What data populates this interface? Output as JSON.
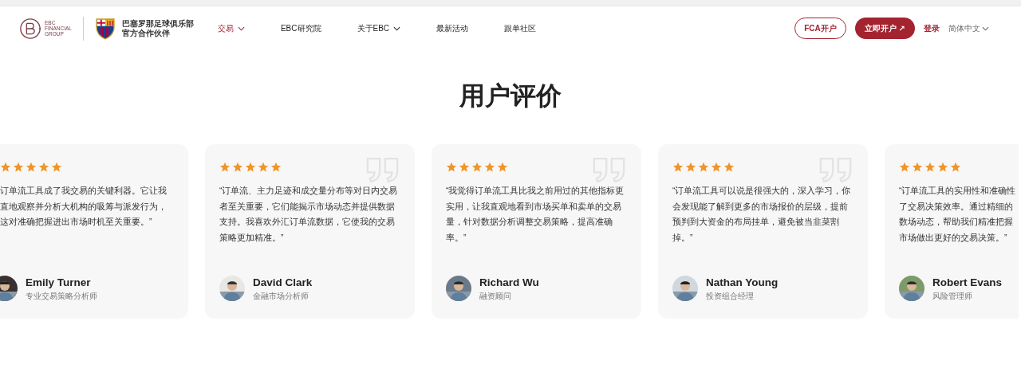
{
  "header": {
    "logo_text": [
      "EBC",
      "FINANCIAL",
      "GROUP"
    ],
    "partner_text": [
      "巴塞罗那足球俱乐部",
      "官方合作伙伴"
    ],
    "nav": [
      {
        "label": "交易",
        "selected": true,
        "dropdown": true
      },
      {
        "label": "EBC研究院",
        "selected": false,
        "dropdown": false
      },
      {
        "label": "关于EBC",
        "selected": false,
        "dropdown": true
      },
      {
        "label": "最新活动",
        "selected": false,
        "dropdown": false
      },
      {
        "label": "跟单社区",
        "selected": false,
        "dropdown": false
      }
    ],
    "fca_button": "FCA开户",
    "open_button": "立即开户 ↗",
    "login": "登录",
    "language": "简体中文"
  },
  "title": "用户评价",
  "reviews": [
    {
      "kind": "cut-left",
      "stars": 5,
      "quote": "订单流工具成了我交易的关键利器。它让我直地观察并分析大机构的吸筹与派发行为，这对准确把握进出市场时机至关重要。”",
      "name": "Emily Turner",
      "role": "专业交易策略分析师"
    },
    {
      "kind": "full",
      "stars": 5,
      "quote": "“订单流、主力足迹和成交量分布等对日内交易者至关重要，它们能揭示市场动态并提供数据支持。我喜欢外汇订单流数据，它使我的交易策略更加精准。”",
      "name": "David Clark",
      "role": "金融市场分析师"
    },
    {
      "kind": "full",
      "stars": 5,
      "quote": "“我觉得订单流工具比我之前用过的其他指标更实用，让我直观地看到市场买单和卖单的交易量，针对数据分析调整交易策略，提高准确率。”",
      "name": "Richard Wu",
      "role": "融资顾问"
    },
    {
      "kind": "full",
      "stars": 5,
      "quote": "“订单流工具可以说是很强大的，深入学习，你会发现能了解到更多的市场报价的层级，提前预判到大资金的布局挂单，避免被当韭菜割掉。”",
      "name": "Nathan Young",
      "role": "投资组合经理"
    },
    {
      "kind": "cut-right",
      "stars": 5,
      "quote": "“订单流工具的实用性和准确性了交易决策效率。通过精细的数场动态，帮助我们精准把握市场做出更好的交易决策。”",
      "name": "Robert Evans",
      "role": "风险管理师"
    }
  ]
}
